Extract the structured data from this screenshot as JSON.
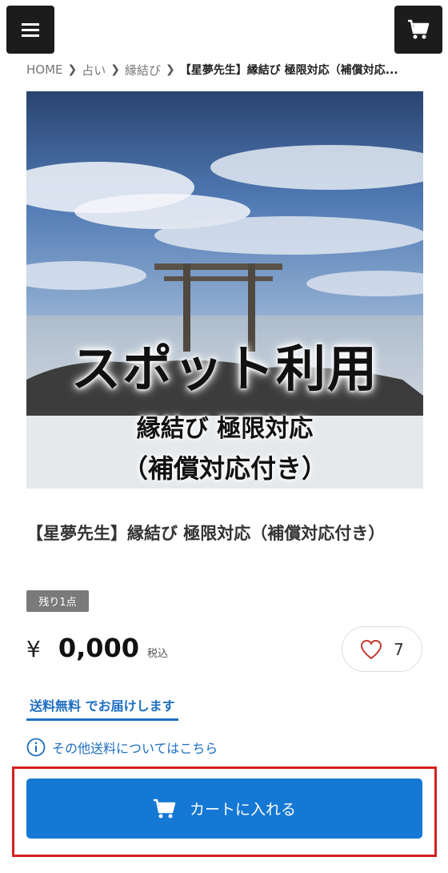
{
  "breadcrumb": {
    "items": [
      "HOME",
      "占い",
      "縁結び"
    ],
    "current": "【星夢先生】縁結び 極限対応（補償対応..."
  },
  "hero": {
    "title": "スポット利用",
    "subtitle1": "縁結び 極限対応",
    "subtitle2": "（補償対応付き）"
  },
  "product": {
    "title": "【星夢先生】縁結び 極限対応（補償対応付き）",
    "stock_badge": "残り1点",
    "currency": "¥",
    "price": "0,000",
    "tax_label": "税込",
    "like_count": "7"
  },
  "shipping": {
    "free_label_em": "送料無料",
    "free_label_rest": " でお届けします",
    "other_link": "その他送料についてはこちら"
  },
  "cart_button": {
    "label": "カートに入れる"
  },
  "icons": {
    "menu": "hamburger-icon",
    "cart": "cart-icon",
    "heart": "heart-icon",
    "info": "info-icon"
  },
  "colors": {
    "accent_blue": "#1478d4",
    "link_blue": "#1e6fc1",
    "highlight_red": "#d42020",
    "header_dark": "#1c1c1c"
  }
}
